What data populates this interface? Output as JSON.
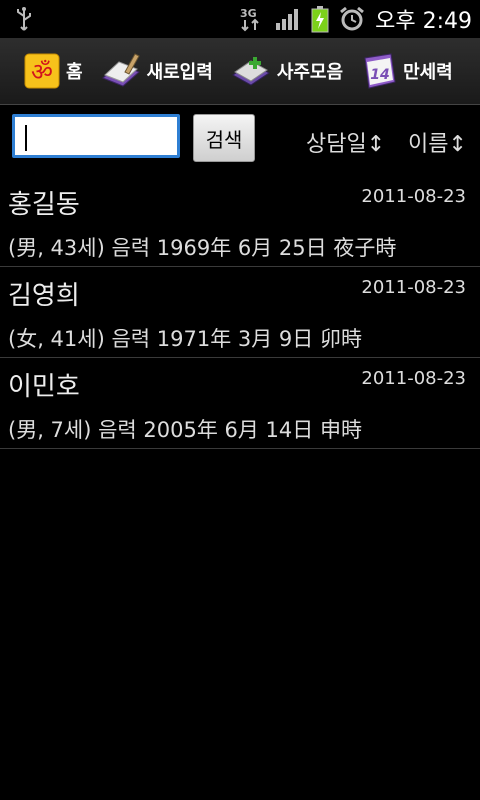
{
  "status_bar": {
    "network": "3G",
    "time": "오후 2:49"
  },
  "toolbar": {
    "items": [
      {
        "label": "홈",
        "icon": "om-icon"
      },
      {
        "label": "새로입력",
        "icon": "notebook-pen-icon"
      },
      {
        "label": "사주모음",
        "icon": "book-collection-icon"
      },
      {
        "label": "만세력",
        "icon": "calendar-icon"
      }
    ]
  },
  "search": {
    "value": "",
    "button_label": "검색"
  },
  "sort": {
    "by_date": "상담일↕",
    "by_name": "이름↕"
  },
  "records": [
    {
      "name": "홍길동",
      "date": "2011-08-23",
      "info": "(男, 43세)  음력 1969年 6月 25日 夜子時"
    },
    {
      "name": "김영희",
      "date": "2011-08-23",
      "info": "(女, 41세)  음력 1971年 3月 9日 卯時"
    },
    {
      "name": "이민호",
      "date": "2011-08-23",
      "info": "(男, 7세)  음력 2005年 6月 14日 申時"
    }
  ],
  "colors": {
    "input_border": "#2f7fd3",
    "battery": "#7cd11a"
  }
}
